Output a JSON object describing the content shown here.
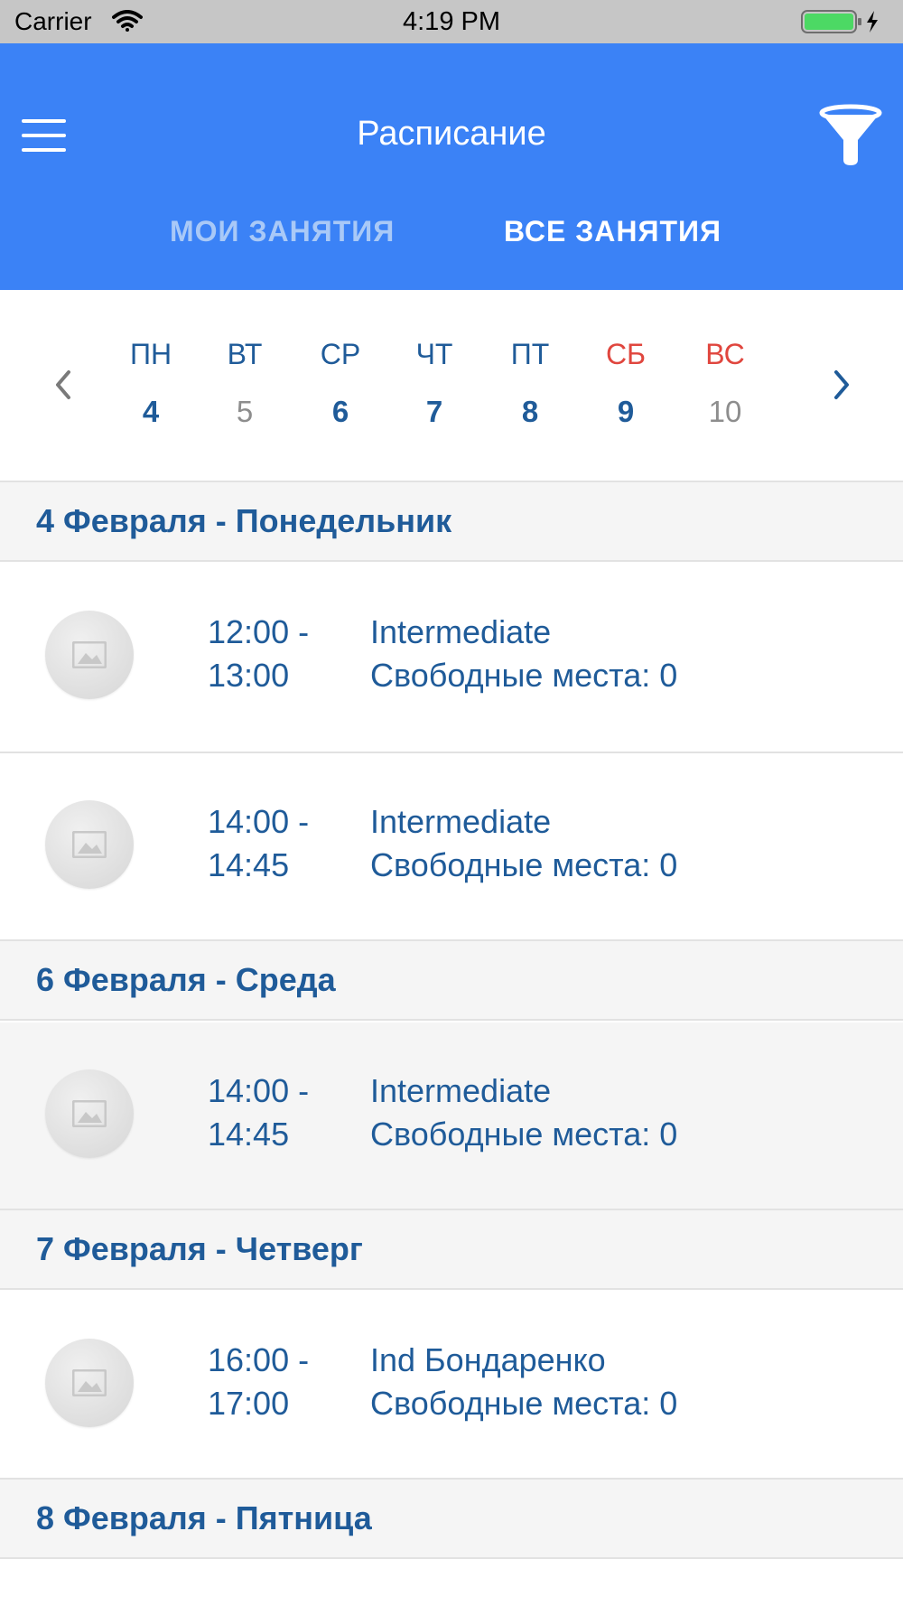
{
  "status_bar": {
    "carrier": "Carrier",
    "time": "4:19 PM"
  },
  "header": {
    "title": "Расписание",
    "tabs": [
      {
        "label": "МОИ ЗАНЯТИЯ",
        "active": false
      },
      {
        "label": "ВСЕ ЗАНЯТИЯ",
        "active": true
      }
    ],
    "color": "#3b82f6"
  },
  "week": {
    "days": [
      {
        "name": "ПН",
        "date": "4"
      },
      {
        "name": "ВТ",
        "date": "5"
      },
      {
        "name": "СР",
        "date": "6"
      },
      {
        "name": "ЧТ",
        "date": "7"
      },
      {
        "name": "ПТ",
        "date": "8"
      },
      {
        "name": "СБ",
        "date": "9"
      },
      {
        "name": "ВС",
        "date": "10"
      }
    ]
  },
  "schedule": [
    {
      "header": "4 Февраля - Понедельник",
      "items": [
        {
          "time_start": "12:00 -",
          "time_end": "13:00",
          "title": "Intermediate",
          "seats": "Свободные места: 0"
        },
        {
          "time_start": "14:00 -",
          "time_end": "14:45",
          "title": "Intermediate",
          "seats": "Свободные места: 0"
        }
      ]
    },
    {
      "header": "6 Февраля - Среда",
      "items": [
        {
          "time_start": "14:00 -",
          "time_end": "14:45",
          "title": "Intermediate",
          "seats": "Свободные места: 0"
        }
      ]
    },
    {
      "header": "7 Февраля - Четверг",
      "items": [
        {
          "time_start": "16:00 -",
          "time_end": "17:00",
          "title": "Ind Бондаренко",
          "seats": "Свободные места: 0"
        }
      ]
    },
    {
      "header": "8 Февраля - Пятница",
      "items": []
    }
  ],
  "icons": {
    "menu": "menu-icon",
    "filter": "filter-icon",
    "prev": "chevron-left-icon",
    "next": "chevron-right-icon",
    "thumb": "image-placeholder-icon"
  }
}
